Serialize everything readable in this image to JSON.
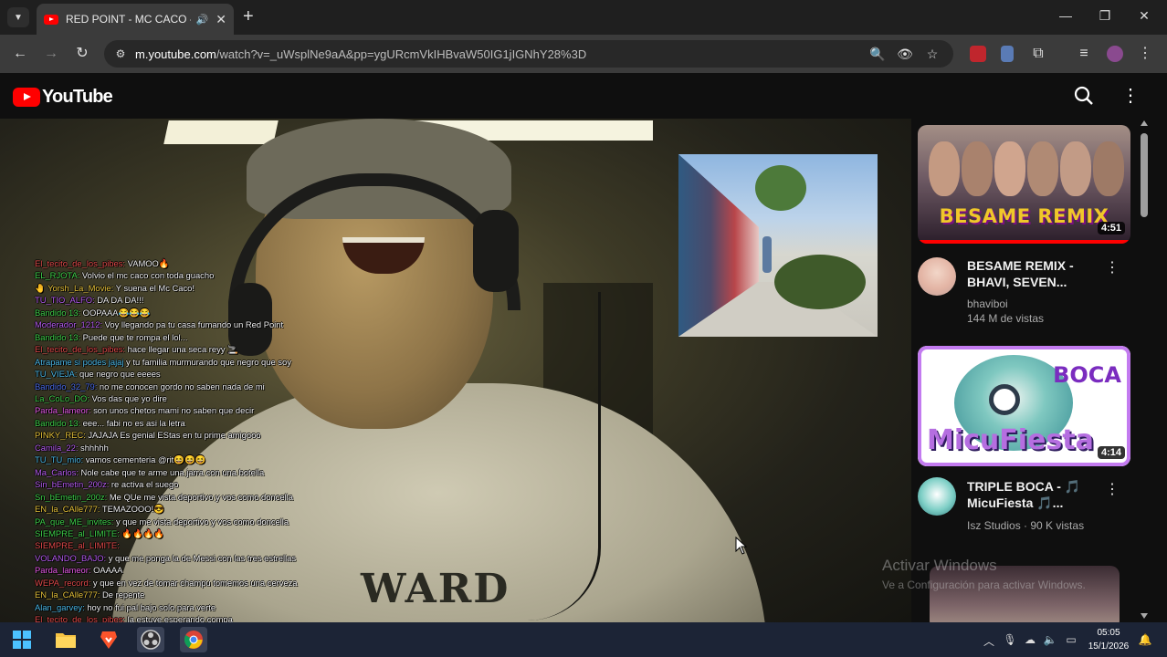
{
  "browser": {
    "tab_title": "RED POINT - MC CACO - VI",
    "tab_audio_icon": "speaker-icon",
    "url_domain": "m.youtube.com",
    "url_path": "/watch?v=_uWsplNe9aA&pp=ygURcmVkIHBvaW50IG1jIGNhY28%3D"
  },
  "youtube": {
    "logo_text": "YouTube"
  },
  "video": {
    "shirt_print": "WARD",
    "chat": [
      {
        "user": "El_tecito_de_los_pibes:",
        "color": "#e24a4a",
        "msg": "VAMOO🔥"
      },
      {
        "user": "EL_RJOTA:",
        "color": "#3fd04a",
        "msg": "Volvio el mc caco con toda guacho"
      },
      {
        "user": "🤚 Yorsh_La_Movie:",
        "color": "#e6c23a",
        "msg": "Y suena el Mc Caco!"
      },
      {
        "user": "TU_TIO_ALFO:",
        "color": "#b65cf0",
        "msg": "DA DA DA!!!"
      },
      {
        "user": "Bandido 13:",
        "color": "#3fd04a",
        "msg": "OOPAAA😂😂😂"
      },
      {
        "user": "Moderador_1212:",
        "color": "#b65cf0",
        "msg": "Voy llegando pa tu casa fumando un Red Point"
      },
      {
        "user": "Bandido 13:",
        "color": "#3fd04a",
        "msg": "Puede que te rompa el lol..."
      },
      {
        "user": "El_tecito_de_los_pibes:",
        "color": "#e24a4a",
        "msg": "hace llegar una seca reyy 🚬"
      },
      {
        "user": "Atrapame si podes jajaj",
        "color": "#4ab7e6",
        "msg": "y tu familia murmurando que negro que soy"
      },
      {
        "user": "TU_VIEJA:",
        "color": "#4ab7e6",
        "msg": "que negro que eeees"
      },
      {
        "user": "Bandido_32_79:",
        "color": "#4a6ae6",
        "msg": "no me conocen gordo no saben nada de mi"
      },
      {
        "user": "La_CoLo_DO:",
        "color": "#3fd04a",
        "msg": "Vos das que yo dire"
      },
      {
        "user": "Parda_lameor:",
        "color": "#e65ae6",
        "msg": "son unos chetos mami no saben que decir"
      },
      {
        "user": "Bandido 13:",
        "color": "#3fd04a",
        "msg": "eee... fabi no es asi la letra"
      },
      {
        "user": "PINKY_REC:",
        "color": "#e6c23a",
        "msg": "JAJAJA Es genial EStas en tu prime amigooo"
      },
      {
        "user": "Camila_22:",
        "color": "#b65cf0",
        "msg": "shhhhh"
      },
      {
        "user": "TU_TU_mio:",
        "color": "#4ab7e6",
        "msg": "vamos cementeria @rit😆😆😆"
      },
      {
        "user": "Ma_Carlos:",
        "color": "#b65cf0",
        "msg": "Nole cabe que te arme una jarra con una botella"
      },
      {
        "user": "Sin_bEmetin_200z:",
        "color": "#b65cf0",
        "msg": "re activa el suego"
      },
      {
        "user": "Sn_bEmetin_200z:",
        "color": "#3fd04a",
        "msg": "Me QUe me vista deportivo y vos como doncella"
      },
      {
        "user": "EN_la_CAlle777:",
        "color": "#e6c23a",
        "msg": "TEMAZOOO!😎"
      },
      {
        "user": "PA_que_ME_invites:",
        "color": "#3fd04a",
        "msg": "y que me vista deportivo y vos como doncella"
      },
      {
        "user": "SIEMPRE_al_LIMITE:",
        "color": "#3fd04a",
        "msg": "🔥🔥🔥🔥"
      },
      {
        "user": "SIEMPRE_al_LIMITE:",
        "color": "#e24a4a",
        "msg": ""
      },
      {
        "user": "VOLANDO_BAJO:",
        "color": "#b65cf0",
        "msg": "y que me ponga la de Messi con las tres estrellas"
      },
      {
        "user": "Parda_lameor:",
        "color": "#e65ae6",
        "msg": "OAAAA"
      },
      {
        "user": "WEPA_record:",
        "color": "#e24a4a",
        "msg": "y que en vez de tomar champu tomemos una cerveza"
      },
      {
        "user": "EN_la_CAlle777:",
        "color": "#e6c23a",
        "msg": "De repente"
      },
      {
        "user": "Alan_garvey:",
        "color": "#4ab7e6",
        "msg": "hoy no fui pal bajo solo para verte"
      },
      {
        "user": "El_tecito_de_los_pibes:",
        "color": "#e24a4a",
        "msg": "la estuve esperando compa"
      }
    ]
  },
  "sidebar": {
    "videos": [
      {
        "thumb_text": "BESAME REMIX",
        "duration": "4:51",
        "title": "BESAME REMIX - BHAVI, SEVEN...",
        "channel": "bhaviboi",
        "views": "144 M de vistas"
      },
      {
        "thumb_text_top": "BOCA",
        "thumb_text_bottom": "MicuFiesta",
        "duration": "4:14",
        "title": "TRIPLE BOCA - 🎵 MicuFiesta 🎵...",
        "channel": "Isz Studios",
        "views": "90 K vistas"
      }
    ]
  },
  "os": {
    "watermark_title": "Activar Windows",
    "watermark_sub": "Ve a Configuración para activar Windows.",
    "clock_time": "05:05",
    "clock_date": "15/1/2026"
  }
}
